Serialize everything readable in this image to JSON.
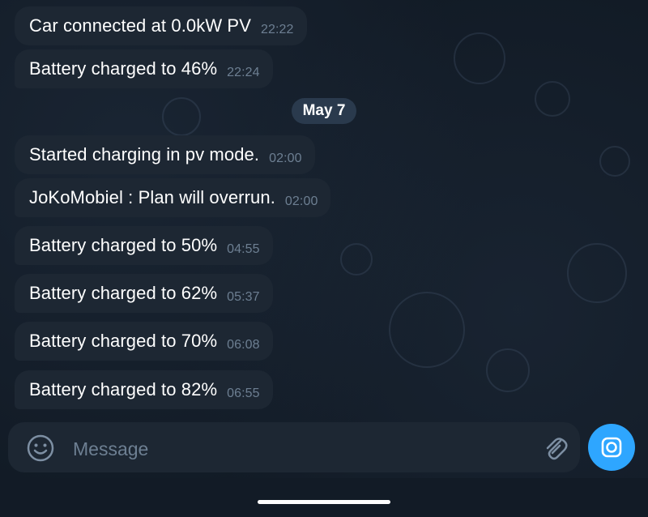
{
  "messages": [
    {
      "text": "Car connected at 0.0kW PV",
      "time": "22:22"
    },
    {
      "text": "Battery charged to 46%",
      "time": "22:24"
    },
    {
      "text": "Started charging in pv mode.",
      "time": "02:00"
    },
    {
      "text": "JoKoMobiel : Plan will overrun.",
      "time": "02:00"
    },
    {
      "text": "Battery charged to 50%",
      "time": "04:55"
    },
    {
      "text": "Battery charged to 62%",
      "time": "05:37"
    },
    {
      "text": "Battery charged to 70%",
      "time": "06:08"
    },
    {
      "text": "Battery charged to 82%",
      "time": "06:55"
    }
  ],
  "date_separator": "May 7",
  "composer": {
    "placeholder": "Message",
    "emoji_icon": "emoji-icon",
    "attach_icon": "paperclip-icon",
    "camera_icon": "camera-icon"
  },
  "colors": {
    "background": "#121b26",
    "bubble": "#1d2733",
    "accent": "#2ea6ff",
    "timestamp": "#6d7f92"
  }
}
